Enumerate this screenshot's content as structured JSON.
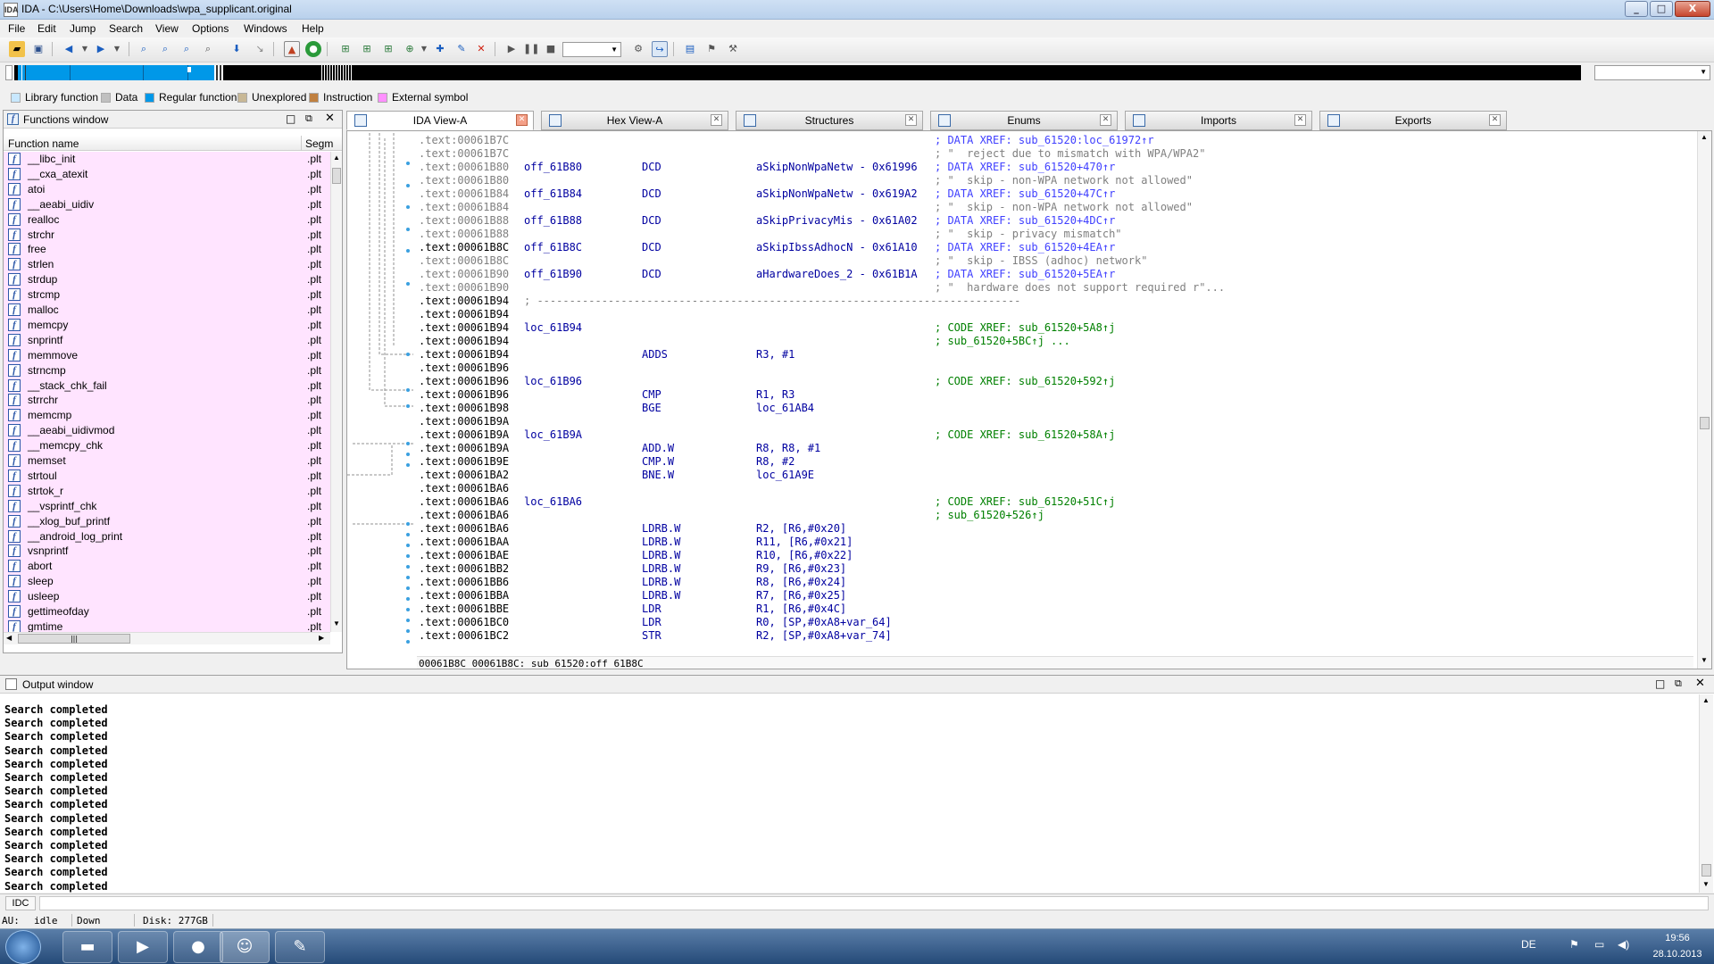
{
  "window": {
    "title": "IDA - C:\\Users\\Home\\Downloads\\wpa_supplicant.original",
    "app_icon": "IDA",
    "min": "_",
    "max": "□",
    "close": "X"
  },
  "menu": [
    "File",
    "Edit",
    "Jump",
    "Search",
    "View",
    "Options",
    "Windows",
    "Help"
  ],
  "legend": [
    {
      "label": "Library function",
      "color": "#c8e8ff"
    },
    {
      "label": "Data",
      "color": "#c0c0c0"
    },
    {
      "label": "Regular function",
      "color": "#0098e8"
    },
    {
      "label": "Unexplored",
      "color": "#c8b896"
    },
    {
      "label": "Instruction",
      "color": "#c08040"
    },
    {
      "label": "External symbol",
      "color": "#ff90ff"
    }
  ],
  "functions_panel": {
    "title": "Functions window",
    "col_name": "Function name",
    "col_segment": "Segm",
    "scroll_glyph": "|||",
    "items": [
      {
        "name": "__libc_init",
        "seg": ".plt"
      },
      {
        "name": "__cxa_atexit",
        "seg": ".plt"
      },
      {
        "name": "atoi",
        "seg": ".plt"
      },
      {
        "name": "__aeabi_uidiv",
        "seg": ".plt"
      },
      {
        "name": "realloc",
        "seg": ".plt"
      },
      {
        "name": "strchr",
        "seg": ".plt"
      },
      {
        "name": "free",
        "seg": ".plt"
      },
      {
        "name": "strlen",
        "seg": ".plt"
      },
      {
        "name": "strdup",
        "seg": ".plt"
      },
      {
        "name": "strcmp",
        "seg": ".plt"
      },
      {
        "name": "malloc",
        "seg": ".plt"
      },
      {
        "name": "memcpy",
        "seg": ".plt"
      },
      {
        "name": "snprintf",
        "seg": ".plt"
      },
      {
        "name": "memmove",
        "seg": ".plt"
      },
      {
        "name": "strncmp",
        "seg": ".plt"
      },
      {
        "name": "__stack_chk_fail",
        "seg": ".plt"
      },
      {
        "name": "strrchr",
        "seg": ".plt"
      },
      {
        "name": "memcmp",
        "seg": ".plt"
      },
      {
        "name": "__aeabi_uidivmod",
        "seg": ".plt"
      },
      {
        "name": "__memcpy_chk",
        "seg": ".plt"
      },
      {
        "name": "memset",
        "seg": ".plt"
      },
      {
        "name": "strtoul",
        "seg": ".plt"
      },
      {
        "name": "strtok_r",
        "seg": ".plt"
      },
      {
        "name": "__vsprintf_chk",
        "seg": ".plt"
      },
      {
        "name": "__xlog_buf_printf",
        "seg": ".plt"
      },
      {
        "name": "__android_log_print",
        "seg": ".plt"
      },
      {
        "name": "vsnprintf",
        "seg": ".plt"
      },
      {
        "name": "abort",
        "seg": ".plt"
      },
      {
        "name": "sleep",
        "seg": ".plt"
      },
      {
        "name": "usleep",
        "seg": ".plt"
      },
      {
        "name": "gettimeofday",
        "seg": ".plt"
      },
      {
        "name": "gmtime",
        "seg": ".plt"
      }
    ]
  },
  "tabs": [
    {
      "label": "IDA View-A",
      "active": true,
      "icon": "disassembly-icon"
    },
    {
      "label": "Hex View-A",
      "active": false,
      "icon": "hex-icon"
    },
    {
      "label": "Structures",
      "active": false,
      "icon": "structures-icon"
    },
    {
      "label": "Enums",
      "active": false,
      "icon": "enums-icon"
    },
    {
      "label": "Imports",
      "active": false,
      "icon": "imports-icon"
    },
    {
      "label": "Exports",
      "active": false,
      "icon": "exports-icon"
    }
  ],
  "disasm": {
    "lines": [
      {
        "addr": ".text:00061B7C",
        "gray": true,
        "lbl": "",
        "mn": "",
        "op": "",
        "cmt": "; DATA XREF: sub_61520:loc_61972↑r",
        "cmt_style": "blue"
      },
      {
        "addr": ".text:00061B7C",
        "gray": true,
        "lbl": "",
        "mn": "",
        "op": "",
        "cmt": "; \"  reject due to mismatch with WPA/WPA2\"",
        "cmt_style": "gray"
      },
      {
        "addr": ".text:00061B80",
        "gray": true,
        "lbl": "off_61B80",
        "mn": "DCD",
        "op": "aSkipNonWpaNetw - 0x61996",
        "cmt": "; DATA XREF: sub_61520+470↑r",
        "cmt_style": "blue"
      },
      {
        "addr": ".text:00061B80",
        "gray": true,
        "lbl": "",
        "mn": "",
        "op": "",
        "cmt": "; \"  skip - non-WPA network not allowed\"",
        "cmt_style": "gray"
      },
      {
        "addr": ".text:00061B84",
        "gray": true,
        "lbl": "off_61B84",
        "mn": "DCD",
        "op": "aSkipNonWpaNetw - 0x619A2",
        "cmt": "; DATA XREF: sub_61520+47C↑r",
        "cmt_style": "blue"
      },
      {
        "addr": ".text:00061B84",
        "gray": true,
        "lbl": "",
        "mn": "",
        "op": "",
        "cmt": "; \"  skip - non-WPA network not allowed\"",
        "cmt_style": "gray"
      },
      {
        "addr": ".text:00061B88",
        "gray": true,
        "lbl": "off_61B88",
        "mn": "DCD",
        "op": "aSkipPrivacyMis - 0x61A02",
        "cmt": "; DATA XREF: sub_61520+4DC↑r",
        "cmt_style": "blue"
      },
      {
        "addr": ".text:00061B88",
        "gray": true,
        "lbl": "",
        "mn": "",
        "op": "",
        "cmt": "; \"  skip - privacy mismatch\"",
        "cmt_style": "gray"
      },
      {
        "addr": ".text:00061B8C",
        "gray": false,
        "lbl": "off_61B8C",
        "mn": "DCD",
        "op": "aSkipIbssAdhocN - 0x61A10",
        "cmt": "; DATA XREF: sub_61520+4EA↑r",
        "cmt_style": "blue"
      },
      {
        "addr": ".text:00061B8C",
        "gray": true,
        "lbl": "",
        "mn": "",
        "op": "",
        "cmt": "; \"  skip - IBSS (adhoc) network\"",
        "cmt_style": "gray"
      },
      {
        "addr": ".text:00061B90",
        "gray": true,
        "lbl": "off_61B90",
        "mn": "DCD",
        "op": "aHardwareDoes_2 - 0x61B1A",
        "cmt": "; DATA XREF: sub_61520+5EA↑r",
        "cmt_style": "blue"
      },
      {
        "addr": ".text:00061B90",
        "gray": true,
        "lbl": "",
        "mn": "",
        "op": "",
        "cmt": "; \"  hardware does not support required r\"...",
        "cmt_style": "gray"
      },
      {
        "addr": ".text:00061B94",
        "gray": false,
        "sep": "; ---------------------------------------------------------------------------"
      },
      {
        "addr": ".text:00061B94",
        "gray": false,
        "lbl": "",
        "mn": "",
        "op": "",
        "cmt": ""
      },
      {
        "addr": ".text:00061B94",
        "gray": false,
        "lbl": "loc_61B94",
        "mn": "",
        "op": "",
        "cmt": "; CODE XREF: sub_61520+5A8↑j",
        "cmt_style": "green"
      },
      {
        "addr": ".text:00061B94",
        "gray": false,
        "lbl": "",
        "mn": "",
        "op": "",
        "cmt": "; sub_61520+5BC↑j ...",
        "cmt_style": "green"
      },
      {
        "addr": ".text:00061B94",
        "gray": false,
        "lbl": "",
        "mn": "ADDS",
        "op": "R3, #1",
        "cmt": ""
      },
      {
        "addr": ".text:00061B96",
        "gray": false,
        "lbl": "",
        "mn": "",
        "op": "",
        "cmt": ""
      },
      {
        "addr": ".text:00061B96",
        "gray": false,
        "lbl": "loc_61B96",
        "mn": "",
        "op": "",
        "cmt": "; CODE XREF: sub_61520+592↑j",
        "cmt_style": "green"
      },
      {
        "addr": ".text:00061B96",
        "gray": false,
        "lbl": "",
        "mn": "CMP",
        "op": "R1, R3",
        "cmt": ""
      },
      {
        "addr": ".text:00061B98",
        "gray": false,
        "lbl": "",
        "mn": "BGE",
        "op": "loc_61AB4",
        "cmt": ""
      },
      {
        "addr": ".text:00061B9A",
        "gray": false,
        "lbl": "",
        "mn": "",
        "op": "",
        "cmt": ""
      },
      {
        "addr": ".text:00061B9A",
        "gray": false,
        "lbl": "loc_61B9A",
        "mn": "",
        "op": "",
        "cmt": "; CODE XREF: sub_61520+58A↑j",
        "cmt_style": "green"
      },
      {
        "addr": ".text:00061B9A",
        "gray": false,
        "lbl": "",
        "mn": "ADD.W",
        "op": "R8, R8, #1",
        "cmt": ""
      },
      {
        "addr": ".text:00061B9E",
        "gray": false,
        "lbl": "",
        "mn": "CMP.W",
        "op": "R8, #2",
        "cmt": ""
      },
      {
        "addr": ".text:00061BA2",
        "gray": false,
        "lbl": "",
        "mn": "BNE.W",
        "op": "loc_61A9E",
        "cmt": ""
      },
      {
        "addr": ".text:00061BA6",
        "gray": false,
        "lbl": "",
        "mn": "",
        "op": "",
        "cmt": ""
      },
      {
        "addr": ".text:00061BA6",
        "gray": false,
        "lbl": "loc_61BA6",
        "mn": "",
        "op": "",
        "cmt": "; CODE XREF: sub_61520+51C↑j",
        "cmt_style": "green"
      },
      {
        "addr": ".text:00061BA6",
        "gray": false,
        "lbl": "",
        "mn": "",
        "op": "",
        "cmt": "; sub_61520+526↑j",
        "cmt_style": "green"
      },
      {
        "addr": ".text:00061BA6",
        "gray": false,
        "lbl": "",
        "mn": "LDRB.W",
        "op": "R2, [R6,#0x20]",
        "cmt": ""
      },
      {
        "addr": ".text:00061BAA",
        "gray": false,
        "lbl": "",
        "mn": "LDRB.W",
        "op": "R11, [R6,#0x21]",
        "cmt": ""
      },
      {
        "addr": ".text:00061BAE",
        "gray": false,
        "lbl": "",
        "mn": "LDRB.W",
        "op": "R10, [R6,#0x22]",
        "cmt": ""
      },
      {
        "addr": ".text:00061BB2",
        "gray": false,
        "lbl": "",
        "mn": "LDRB.W",
        "op": "R9, [R6,#0x23]",
        "cmt": ""
      },
      {
        "addr": ".text:00061BB6",
        "gray": false,
        "lbl": "",
        "mn": "LDRB.W",
        "op": "R8, [R6,#0x24]",
        "cmt": ""
      },
      {
        "addr": ".text:00061BBA",
        "gray": false,
        "lbl": "",
        "mn": "LDRB.W",
        "op": "R7, [R6,#0x25]",
        "cmt": ""
      },
      {
        "addr": ".text:00061BBE",
        "gray": false,
        "lbl": "",
        "mn": "LDR",
        "op": "R1, [R6,#0x4C]",
        "cmt": ""
      },
      {
        "addr": ".text:00061BC0",
        "gray": false,
        "lbl": "",
        "mn": "LDR",
        "op": "R0, [SP,#0xA8+var_64]",
        "cmt": ""
      },
      {
        "addr": ".text:00061BC2",
        "gray": false,
        "lbl": "",
        "mn": "STR",
        "op": "R2, [SP,#0xA8+var_74]",
        "cmt": ""
      }
    ],
    "status_line": "00061B8C 00061B8C: sub_61520:off_61B8C"
  },
  "output": {
    "title": "Output window",
    "lines": [
      "Search completed",
      "Search completed",
      "Search completed",
      "Search completed",
      "Search completed",
      "Search completed",
      "Search completed",
      "Search completed",
      "Search completed",
      "Search completed",
      "Search completed",
      "Search completed",
      "Search completed",
      "Search completed"
    ]
  },
  "idc": {
    "label": "IDC"
  },
  "status": {
    "au_label": "AU:",
    "au_value": "idle",
    "direction": "Down",
    "disk": "Disk: 277GB"
  },
  "taskbar": {
    "language": "DE",
    "time": "19:56",
    "date": "28.10.2013"
  }
}
